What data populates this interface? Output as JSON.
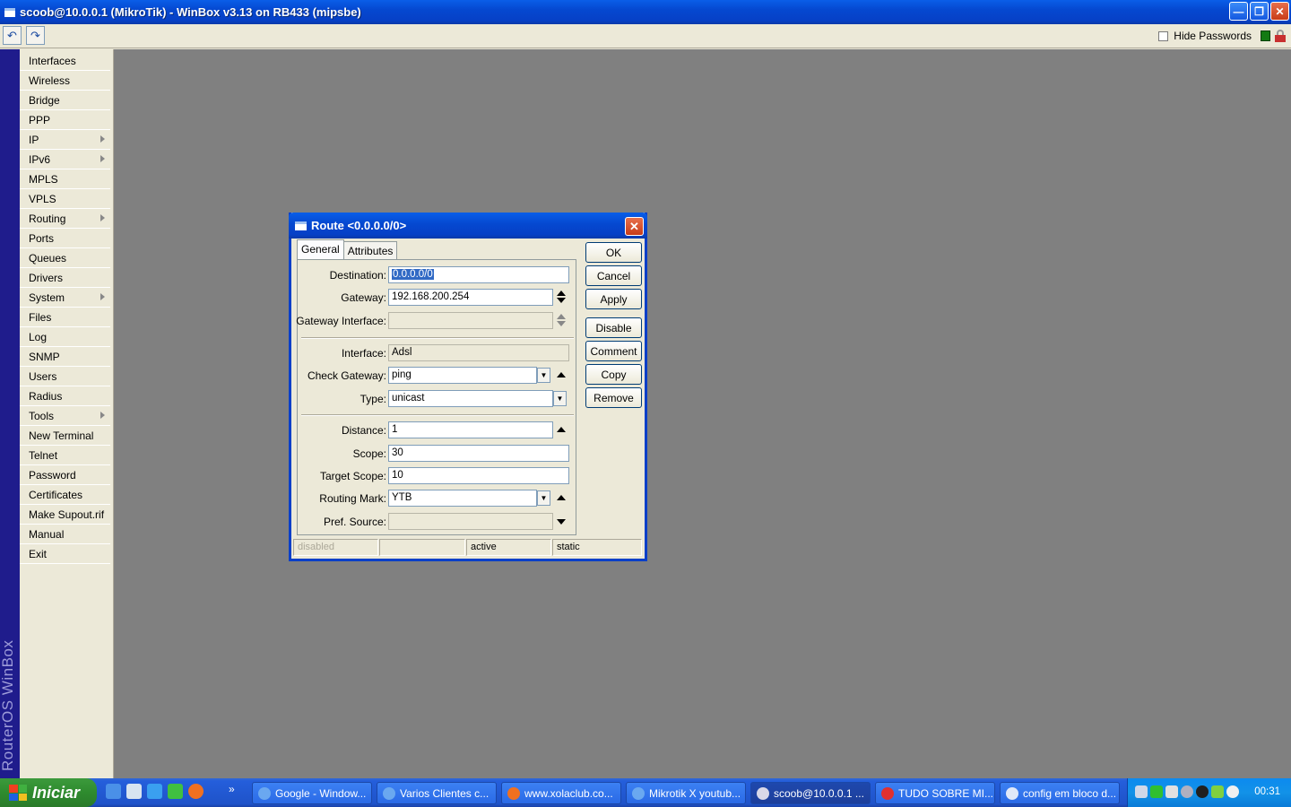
{
  "window": {
    "title": "scoob@10.0.0.1 (MikroTik) - WinBox v3.13 on RB433 (mipsbe)"
  },
  "toolbar": {
    "hide_passwords_label": "Hide Passwords"
  },
  "brand": "RouterOS WinBox",
  "sidebar": {
    "items": [
      {
        "label": "Interfaces",
        "submenu": false
      },
      {
        "label": "Wireless",
        "submenu": false
      },
      {
        "label": "Bridge",
        "submenu": false
      },
      {
        "label": "PPP",
        "submenu": false
      },
      {
        "label": "IP",
        "submenu": true
      },
      {
        "label": "IPv6",
        "submenu": true
      },
      {
        "label": "MPLS",
        "submenu": false
      },
      {
        "label": "VPLS",
        "submenu": false
      },
      {
        "label": "Routing",
        "submenu": true
      },
      {
        "label": "Ports",
        "submenu": false
      },
      {
        "label": "Queues",
        "submenu": false
      },
      {
        "label": "Drivers",
        "submenu": false
      },
      {
        "label": "System",
        "submenu": true
      },
      {
        "label": "Files",
        "submenu": false
      },
      {
        "label": "Log",
        "submenu": false
      },
      {
        "label": "SNMP",
        "submenu": false
      },
      {
        "label": "Users",
        "submenu": false
      },
      {
        "label": "Radius",
        "submenu": false
      },
      {
        "label": "Tools",
        "submenu": true
      },
      {
        "label": "New Terminal",
        "submenu": false
      },
      {
        "label": "Telnet",
        "submenu": false
      },
      {
        "label": "Password",
        "submenu": false
      },
      {
        "label": "Certificates",
        "submenu": false
      },
      {
        "label": "Make Supout.rif",
        "submenu": false
      },
      {
        "label": "Manual",
        "submenu": false
      },
      {
        "label": "Exit",
        "submenu": false
      }
    ]
  },
  "dialog": {
    "title": "Route <0.0.0.0/0>",
    "tabs": [
      "General",
      "Attributes"
    ],
    "fields": {
      "destination": {
        "label": "Destination:",
        "value": "0.0.0.0/0"
      },
      "gateway": {
        "label": "Gateway:",
        "value": "192.168.200.254"
      },
      "gateway_interface": {
        "label": "Gateway Interface:",
        "value": ""
      },
      "interface": {
        "label": "Interface:",
        "value": "Adsl"
      },
      "check_gateway": {
        "label": "Check Gateway:",
        "value": "ping"
      },
      "type": {
        "label": "Type:",
        "value": "unicast"
      },
      "distance": {
        "label": "Distance:",
        "value": "1"
      },
      "scope": {
        "label": "Scope:",
        "value": "30"
      },
      "target_scope": {
        "label": "Target Scope:",
        "value": "10"
      },
      "routing_mark": {
        "label": "Routing Mark:",
        "value": "YTB"
      },
      "pref_source": {
        "label": "Pref. Source:",
        "value": ""
      }
    },
    "buttons": {
      "ok": "OK",
      "cancel": "Cancel",
      "apply": "Apply",
      "disable": "Disable",
      "comment": "Comment",
      "copy": "Copy",
      "remove": "Remove"
    },
    "status": [
      "disabled",
      "",
      "active",
      "static"
    ]
  },
  "taskbar": {
    "start_label": "Iniciar",
    "tasks": [
      {
        "label": "Google - Window...",
        "active": false
      },
      {
        "label": "Varios Clientes c...",
        "active": false
      },
      {
        "label": "www.xolaclub.co...",
        "active": false
      },
      {
        "label": "Mikrotik X youtub...",
        "active": false
      },
      {
        "label": "scoob@10.0.0.1 ...",
        "active": true
      },
      {
        "label": "TUDO SOBRE MI...",
        "active": false
      },
      {
        "label": "config em bloco d...",
        "active": false
      }
    ],
    "clock": "00:31"
  },
  "colors": {
    "titlebar": "#0548d0",
    "brand_bar": "#1f1c8c",
    "workspace": "#808080",
    "selection": "#316ac5",
    "taskbar": "#245edb",
    "start_button": "#2e8b2e"
  }
}
